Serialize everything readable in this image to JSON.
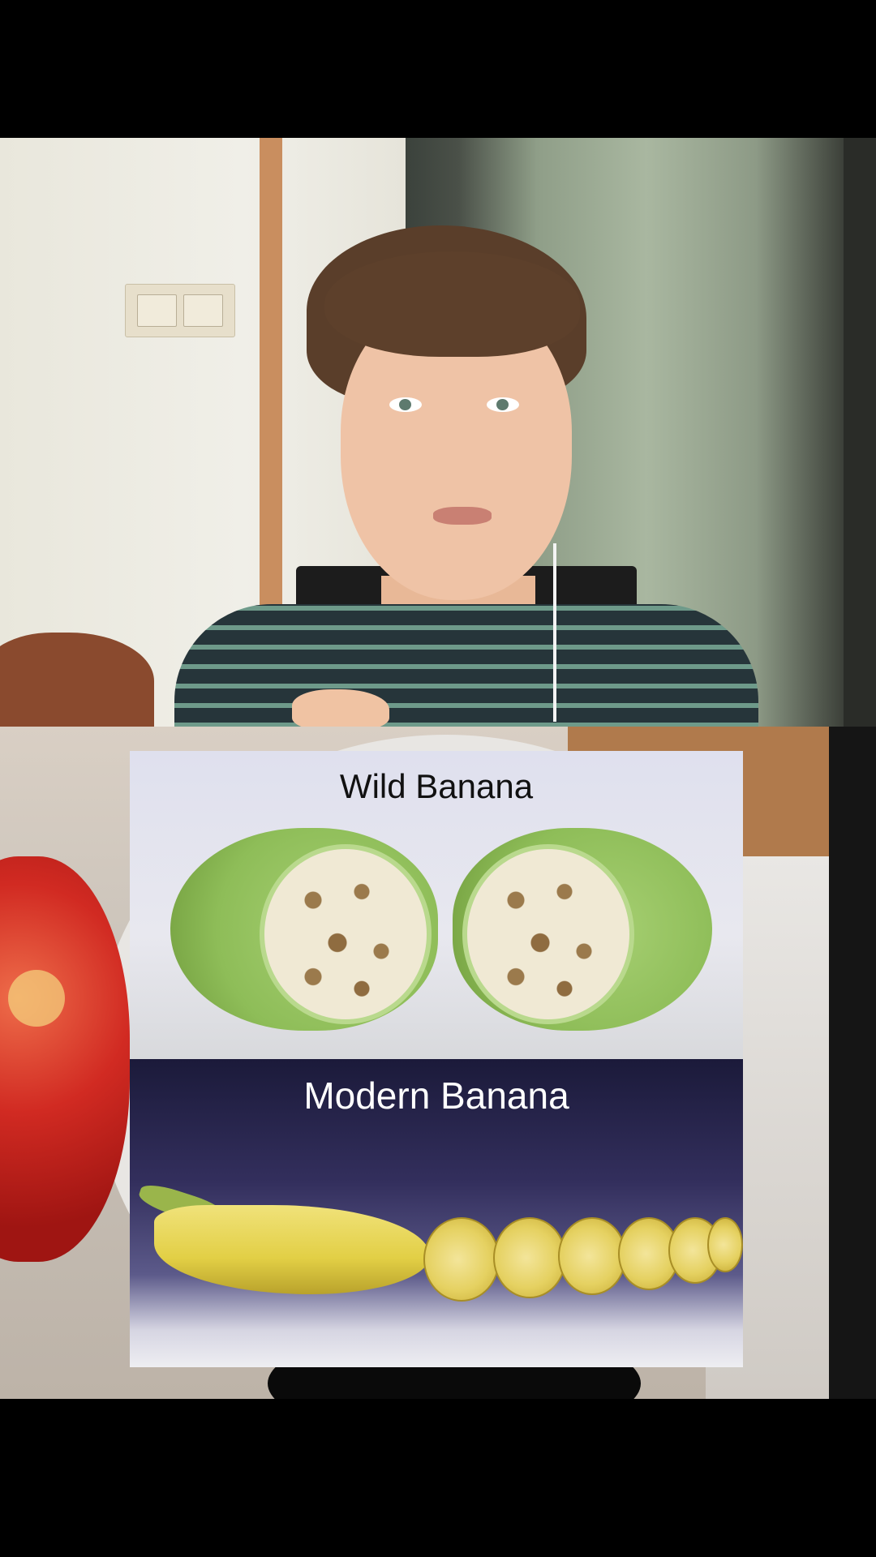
{
  "video": {
    "speaker_scene": "speaker",
    "comparison": {
      "top_label": "Wild Banana",
      "bottom_label": "Modern Banana"
    }
  },
  "colors": {
    "letterbox": "#000000",
    "shirt_stripe": "#6e9a8a",
    "modern_panel_bg": "#1b1a3a"
  }
}
